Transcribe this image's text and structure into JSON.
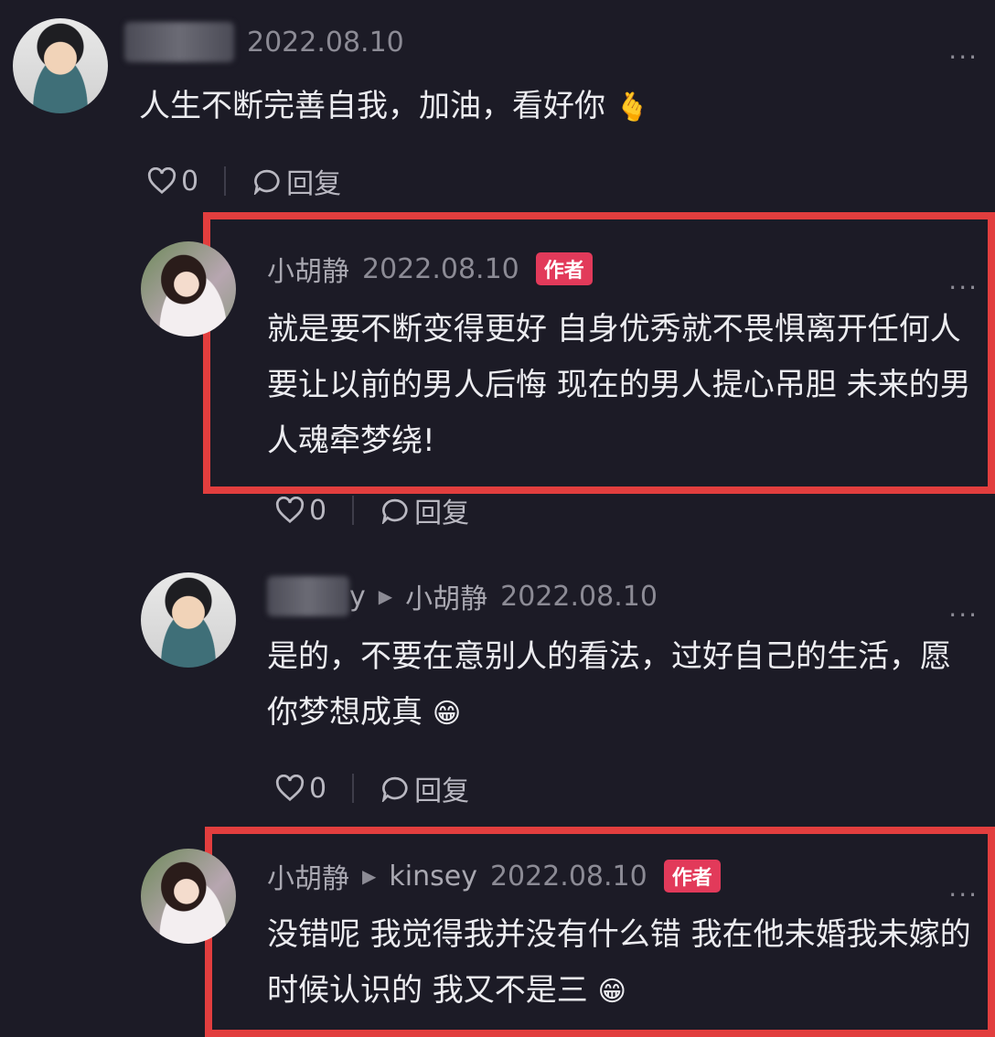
{
  "comments": [
    {
      "author": "",
      "date": "2022.08.10",
      "text": "人生不断完善自我，加油，看好你",
      "emoji": "🫰",
      "likes": "0",
      "reply_label": "回复",
      "more": "..."
    },
    {
      "author": "小胡静",
      "date": "2022.08.10",
      "badge": "作者",
      "text": "就是要不断变得更好 自身优秀就不畏惧离开任何人 要让以前的男人后悔 现在的男人提心吊胆 未来的男人魂牵梦绕!",
      "likes": "0",
      "reply_label": "回复",
      "more": "..."
    },
    {
      "author_partial": "y",
      "reply_to": "小胡静",
      "date": "2022.08.10",
      "text": "是的，不要在意别人的看法，过好自己的生活，愿你梦想成真",
      "emoji": "😁",
      "likes": "0",
      "reply_label": "回复",
      "more": "..."
    },
    {
      "author": "小胡静",
      "reply_to": "kinsey",
      "date": "2022.08.10",
      "badge": "作者",
      "text": "没错呢 我觉得我并没有什么错 我在他未婚我未嫁的时候认识的 我又不是三",
      "emoji": "😁",
      "more": "..."
    }
  ],
  "colors": {
    "background": "#1c1b26",
    "highlight": "#e23e3e",
    "badge": "#e23a5a"
  }
}
